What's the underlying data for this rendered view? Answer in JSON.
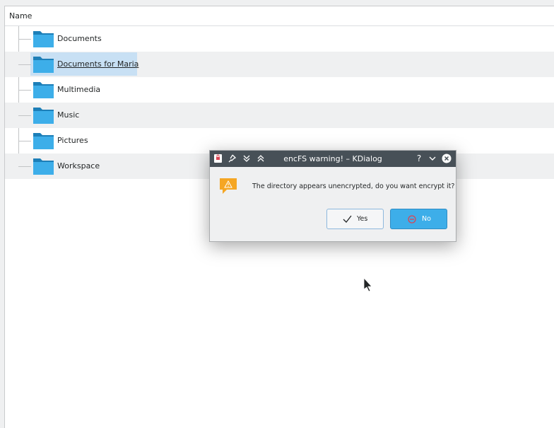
{
  "header": {
    "name_column": "Name"
  },
  "folders": [
    {
      "label": "Documents"
    },
    {
      "label": "Documents for Maria"
    },
    {
      "label": "Multimedia"
    },
    {
      "label": "Music"
    },
    {
      "label": "Pictures"
    },
    {
      "label": "Workspace"
    }
  ],
  "dialog": {
    "title": "encFS warning! – KDialog",
    "message": "The directory appears unencrypted, do you want encrypt it?",
    "yes_label": "Yes",
    "no_label": "No",
    "help_glyph": "?"
  },
  "colors": {
    "selection": "#c8e0f4",
    "folder": "#2ea0d8",
    "titlebar": "#475057",
    "accent_button": "#3daee9",
    "warning": "#f5a623"
  },
  "icons": [
    "folder-icon",
    "warning-icon",
    "checkmark-icon",
    "cancel-icon",
    "pin-icon",
    "close-icon",
    "minimize-icon",
    "maximize-icon",
    "keep-below-icon",
    "keep-above-icon",
    "menu-icon",
    "help-icon"
  ]
}
